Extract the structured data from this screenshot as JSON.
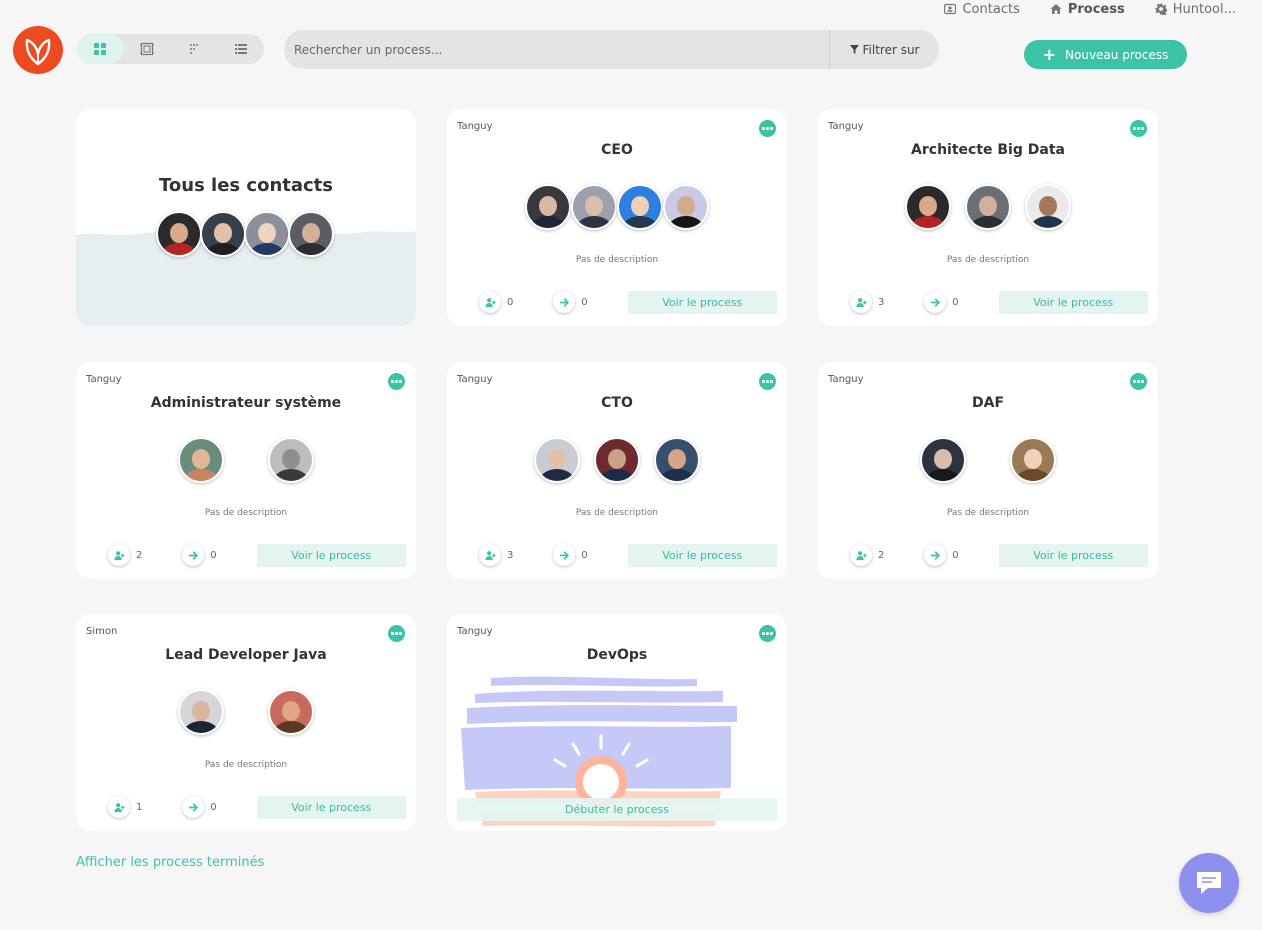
{
  "nav": {
    "items": [
      {
        "label": "Contacts",
        "icon": "id-card-icon",
        "active": false
      },
      {
        "label": "Process",
        "icon": "home-icon",
        "active": true
      },
      {
        "label": "Huntool...",
        "icon": "gear-icon",
        "active": false
      }
    ]
  },
  "search": {
    "placeholder": "Rechercher un process...",
    "value": "",
    "filter_label": "Filtrer sur"
  },
  "toolbar": {
    "new_process_label": "Nouveau process"
  },
  "contacts_card": {
    "title": "Tous les contacts"
  },
  "cards": [
    {
      "owner": "Tanguy",
      "title": "CEO",
      "description": "Pas de description",
      "candidates": "0",
      "moves": "0",
      "action": "Voir le process"
    },
    {
      "owner": "Tanguy",
      "title": "Architecte Big Data",
      "description": "Pas de description",
      "candidates": "3",
      "moves": "0",
      "action": "Voir le process"
    },
    {
      "owner": "Tanguy",
      "title": "Administrateur système",
      "description": "Pas de description",
      "candidates": "2",
      "moves": "0",
      "action": "Voir le process"
    },
    {
      "owner": "Tanguy",
      "title": "CTO",
      "description": "Pas de description",
      "candidates": "3",
      "moves": "0",
      "action": "Voir le process"
    },
    {
      "owner": "Tanguy",
      "title": "DAF",
      "description": "Pas de description",
      "candidates": "2",
      "moves": "0",
      "action": "Voir le process"
    },
    {
      "owner": "Simon",
      "title": "Lead Developer Java",
      "description": "Pas de description",
      "candidates": "1",
      "moves": "0",
      "action": "Voir le process"
    }
  ],
  "devops_card": {
    "owner": "Tanguy",
    "title": "DevOps",
    "action": "Débuter le process"
  },
  "footer": {
    "finished_link": "Afficher les process terminés"
  },
  "colors": {
    "accent": "#3cc3a6",
    "logo": "#ee4a1f",
    "chat": "#8e90f0"
  }
}
